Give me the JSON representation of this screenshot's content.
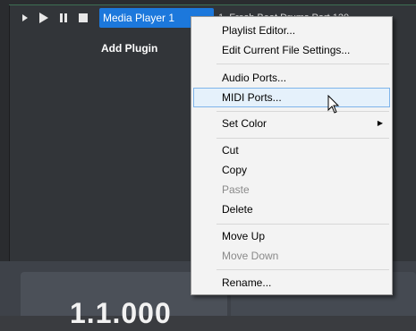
{
  "player": {
    "title": "Media Player 1",
    "track": "1. Fresh Beat Drums Part 120",
    "add_plugin": "Add Plugin",
    "counter": "1.1.000"
  },
  "transport": {
    "icons": [
      "play-small-icon",
      "play-icon",
      "pause-icon",
      "stop-icon"
    ]
  },
  "menu": {
    "items": [
      {
        "label": "Playlist Editor...",
        "enabled": true
      },
      {
        "label": "Edit Current File Settings...",
        "enabled": true
      },
      {
        "label": "Audio Ports...",
        "enabled": true
      },
      {
        "label": "MIDI Ports...",
        "enabled": true,
        "hover": true
      },
      {
        "label": "Set Color",
        "enabled": true,
        "submenu": true
      },
      {
        "label": "Cut",
        "enabled": true
      },
      {
        "label": "Copy",
        "enabled": true
      },
      {
        "label": "Paste",
        "enabled": false
      },
      {
        "label": "Delete",
        "enabled": true
      },
      {
        "label": "Move Up",
        "enabled": true
      },
      {
        "label": "Move Down",
        "enabled": false
      },
      {
        "label": "Rename...",
        "enabled": true
      }
    ]
  },
  "colors": {
    "accent": "#1c78dc",
    "menu_bg": "#f3f3f3",
    "hover_bg": "#e5f1fb",
    "hover_border": "#7eb4ea",
    "disabled_text": "#8a8a8a"
  }
}
